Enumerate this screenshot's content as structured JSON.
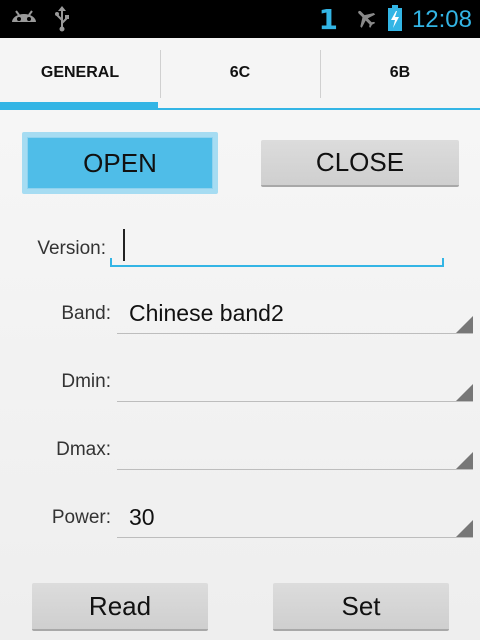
{
  "status_bar": {
    "notification_count": "1",
    "time": "12:08",
    "left_icons": [
      "android-debug-icon",
      "usb-icon"
    ],
    "right_icons": [
      "airplane-icon",
      "battery-charging-icon"
    ]
  },
  "tabs": [
    {
      "label": "GENERAL",
      "active": true
    },
    {
      "label": "6C",
      "active": false
    },
    {
      "label": "6B",
      "active": false
    }
  ],
  "buttons": {
    "open": "OPEN",
    "close": "CLOSE",
    "read": "Read",
    "set": "Set"
  },
  "form": {
    "version": {
      "label": "Version:",
      "value": ""
    },
    "band": {
      "label": "Band:",
      "value": "Chinese band2"
    },
    "dmin": {
      "label": "Dmin:",
      "value": ""
    },
    "dmax": {
      "label": "Dmax:",
      "value": ""
    },
    "power": {
      "label": "Power:",
      "value": "30"
    }
  },
  "colors": {
    "accent": "#33b5e5",
    "open_button": "#4fbde8"
  }
}
